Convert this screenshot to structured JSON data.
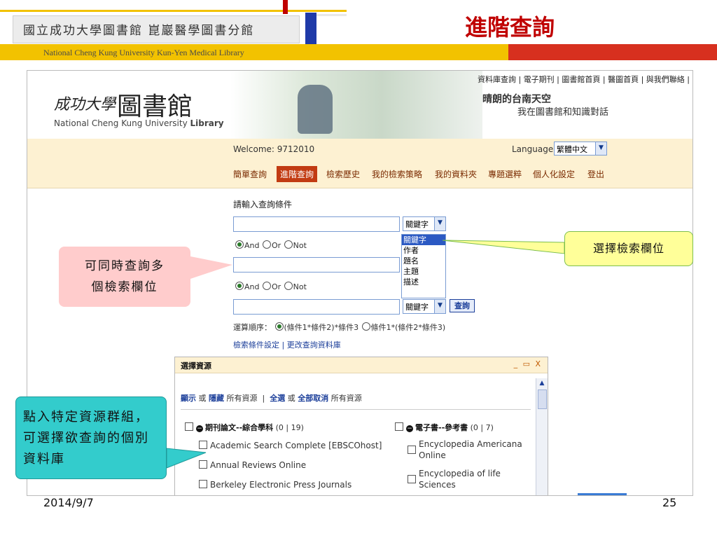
{
  "slide": {
    "title": "進階查詢",
    "header_cn": "國立成功大學圖書館 崑巖醫學圖書分館",
    "header_en": "National Cheng Kung University Kun-Yen Medical Library",
    "footer_date": "2014/9/7",
    "footer_page": "25",
    "colors": {
      "title": "#c00000",
      "yellow_bar": "#f2c200",
      "red_bar": "#d7301f",
      "blue_block": "#1f3aa8"
    }
  },
  "site": {
    "logo_cn_script": "成功大學",
    "logo_cn_big": "圖書館",
    "logo_en_prefix": "National Cheng Kung University ",
    "logo_en_bold": "Library",
    "top_links": [
      "資料庫查詢",
      "電子期刊",
      "圖書館首頁",
      "醫圖首頁",
      "與我們聯絡"
    ],
    "slogan_1": "晴朗的台南天空",
    "slogan_2": "我在圖書館和知識對話",
    "welcome": "Welcome: 9712010",
    "language_label": "Language:",
    "language_value": "繁體中文",
    "nav": [
      "簡單查詢",
      "進階查詢",
      "檢索歷史",
      "我的檢索策略",
      "我的資料夾",
      "專題選粹",
      "個人化設定",
      "登出"
    ]
  },
  "form": {
    "label": "請輸入查詢條件",
    "field_select_value": "關鍵字",
    "bool_and": "And",
    "bool_or": "Or",
    "bool_not": "Not",
    "dropdown_options": [
      "關鍵字",
      "作者",
      "題名",
      "主題",
      "描述"
    ],
    "search_button": "查詢",
    "order_label": "運算順序：",
    "order_opt1": "(條件1*條件2)*條件3",
    "order_opt2": "條件1*(條件2*條件3)",
    "link_settings": "檢索條件設定",
    "link_sep": "|",
    "link_change_db": "更改查詢資料庫"
  },
  "panel": {
    "title": "選擇資源",
    "controls": "_ ▭ X",
    "show": "顯示",
    "or": "或",
    "hide": "隱藏",
    "all_resources": "所有資源",
    "divider": "|",
    "select_all": "全選",
    "deselect_all": "全部取消",
    "group1": {
      "name": "期刊論文--綜合學科",
      "count": "(0 | 19)",
      "items": [
        "Academic Search Complete [EBSCOhost]",
        "Annual Reviews Online",
        "Berkeley Electronic Press Journals"
      ]
    },
    "group2": {
      "name": "電子書--參考書",
      "count": "(0 | 7)",
      "items": [
        "Encyclopedia Americana Online",
        "Encyclopedia of life Sciences"
      ]
    }
  },
  "annotations": {
    "right": "選擇檢索欄位",
    "left1_line1": "可同時查詢多",
    "left1_line2": "個檢索欄位",
    "left2": "點入特定資源群組，可選擇欲查詢的個別資料庫"
  }
}
